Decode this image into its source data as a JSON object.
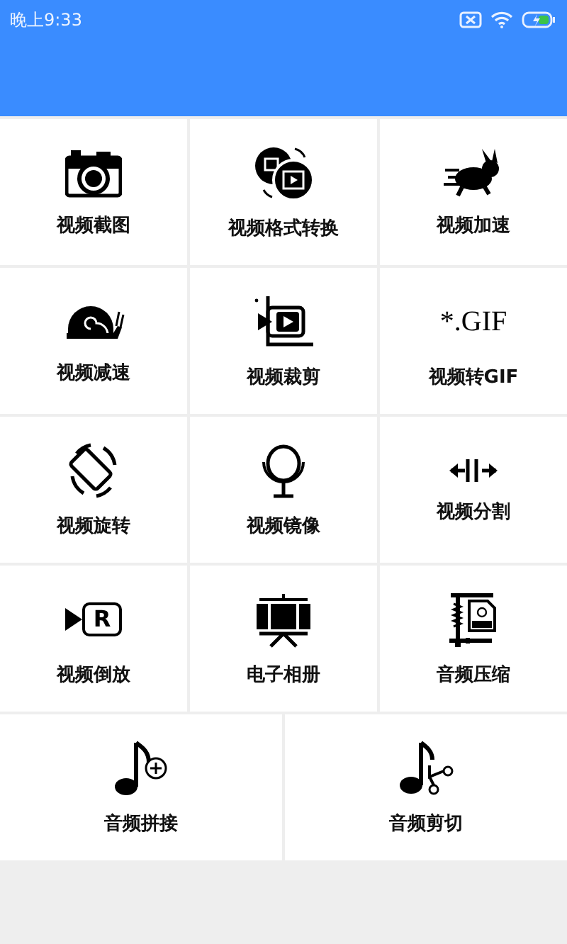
{
  "status_bar": {
    "time": "晚上9:33"
  },
  "rows": [
    [
      {
        "kind": "camera",
        "label": "视频截图"
      },
      {
        "kind": "convert",
        "label": "视频格式转换"
      },
      {
        "kind": "rabbit",
        "label": "视频加速"
      }
    ],
    [
      {
        "kind": "snail",
        "label": "视频减速"
      },
      {
        "kind": "crop",
        "label": "视频裁剪"
      },
      {
        "kind": "gif",
        "label": "视频转GIF",
        "icon_text": "*.GIF"
      }
    ],
    [
      {
        "kind": "rotate",
        "label": "视频旋转"
      },
      {
        "kind": "mirror",
        "label": "视频镜像"
      },
      {
        "kind": "split",
        "label": "视频分割"
      }
    ],
    [
      {
        "kind": "reverse",
        "label": "视频倒放",
        "icon_text": "R"
      },
      {
        "kind": "album",
        "label": "电子相册"
      },
      {
        "kind": "compress",
        "label": "音频压缩"
      }
    ],
    [
      {
        "kind": "note-plus",
        "label": "音频拼接"
      },
      {
        "kind": "note-cut",
        "label": "音频剪切"
      }
    ]
  ]
}
